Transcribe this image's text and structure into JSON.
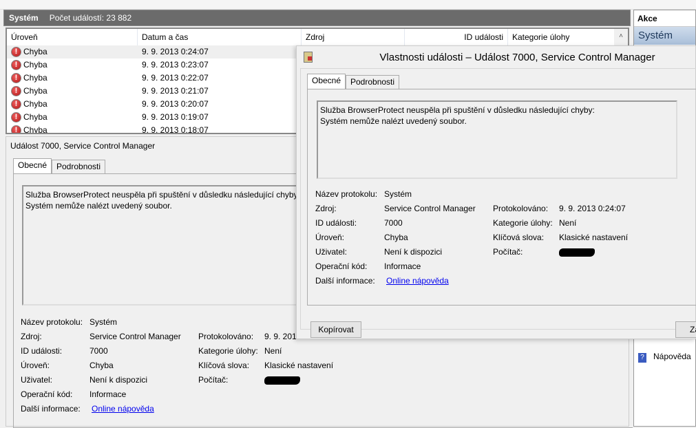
{
  "log": {
    "name": "Systém",
    "count_label": "Počet událostí: 23 882"
  },
  "table": {
    "columns": [
      "Úroveň",
      "Datum a čas",
      "Zdroj",
      "ID události",
      "Kategorie úlohy"
    ],
    "rows": [
      {
        "level": "Chyba",
        "datetime": "9. 9. 2013 0:24:07"
      },
      {
        "level": "Chyba",
        "datetime": "9. 9. 2013 0:23:07"
      },
      {
        "level": "Chyba",
        "datetime": "9. 9. 2013 0:22:07"
      },
      {
        "level": "Chyba",
        "datetime": "9. 9. 2013 0:21:07"
      },
      {
        "level": "Chyba",
        "datetime": "9. 9. 2013 0:20:07"
      },
      {
        "level": "Chyba",
        "datetime": "9. 9. 2013 0:19:07"
      },
      {
        "level": "Chyba",
        "datetime": "9. 9. 2013 0:18:07"
      }
    ]
  },
  "detail": {
    "title": "Událost 7000, Service Control Manager",
    "tabs": [
      "Obecné",
      "Podrobnosti"
    ],
    "message_line1": "Služba BrowserProtect neuspěla při spuštění v důsledku následující chyby:",
    "message_line2": "Systém nemůže nalézt uvedený soubor.",
    "fields": {
      "log_name_label": "Název protokolu:",
      "log_name": "Systém",
      "source_label": "Zdroj:",
      "source": "Service Control Manager",
      "event_id_label": "ID události:",
      "event_id": "7000",
      "level_label": "Úroveň:",
      "level": "Chyba",
      "user_label": "Uživatel:",
      "user": "Není k dispozici",
      "opcode_label": "Operační kód:",
      "opcode": "Informace",
      "more_info_label": "Další informace:",
      "more_info_link": "Online nápověda",
      "logged_label": "Protokolováno:",
      "logged": "9. 9. 2013 0:24:07",
      "logged_trunc": "9. 9. 2013",
      "task_label": "Kategorie úlohy:",
      "task": "Není",
      "keywords_label": "Klíčová slova:",
      "keywords": "Klasické nastavení",
      "computer_label": "Počítač:"
    }
  },
  "actions": {
    "header": "Akce",
    "selected": "Systém",
    "help": "Nápověda"
  },
  "dialog": {
    "title": "Vlastnosti události – Událost 7000, Service Control Manager",
    "copy_button": "Kopírovat",
    "close_button": "Za"
  }
}
